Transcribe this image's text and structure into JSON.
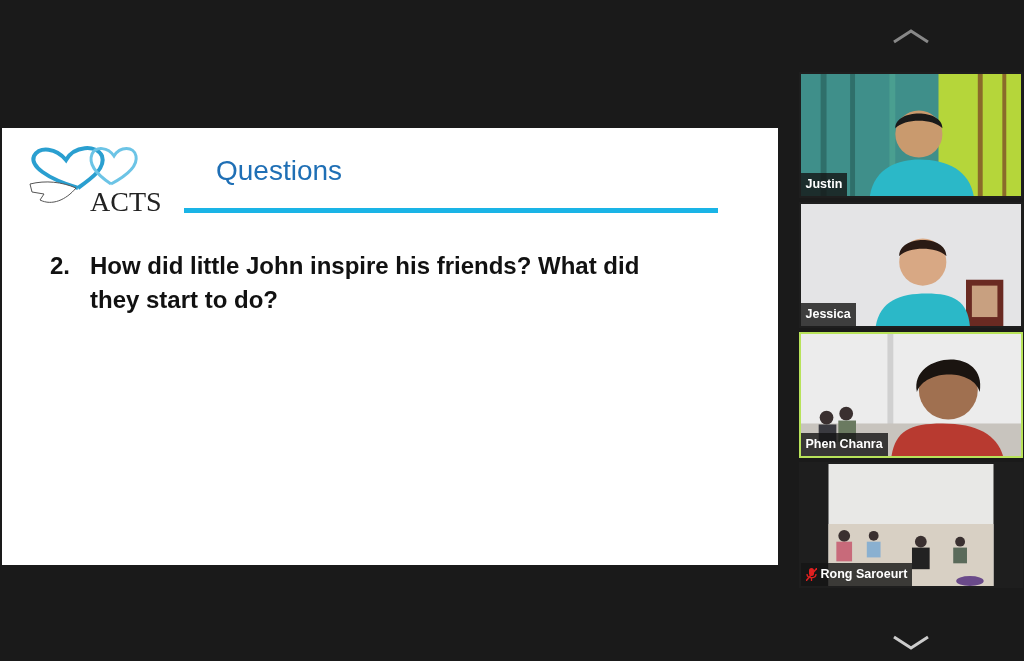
{
  "slide": {
    "logo_text": "ACTS",
    "title": "Questions",
    "question": {
      "number": "2.",
      "text": "How did little John inspire his friends? What did they start to do?"
    }
  },
  "participants": [
    {
      "name": "Justin",
      "speaking": false,
      "muted": false
    },
    {
      "name": "Jessica",
      "speaking": false,
      "muted": false
    },
    {
      "name": "Phen Chanra",
      "speaking": true,
      "muted": false
    },
    {
      "name": "Rong Saroeurt",
      "speaking": false,
      "muted": true
    }
  ]
}
